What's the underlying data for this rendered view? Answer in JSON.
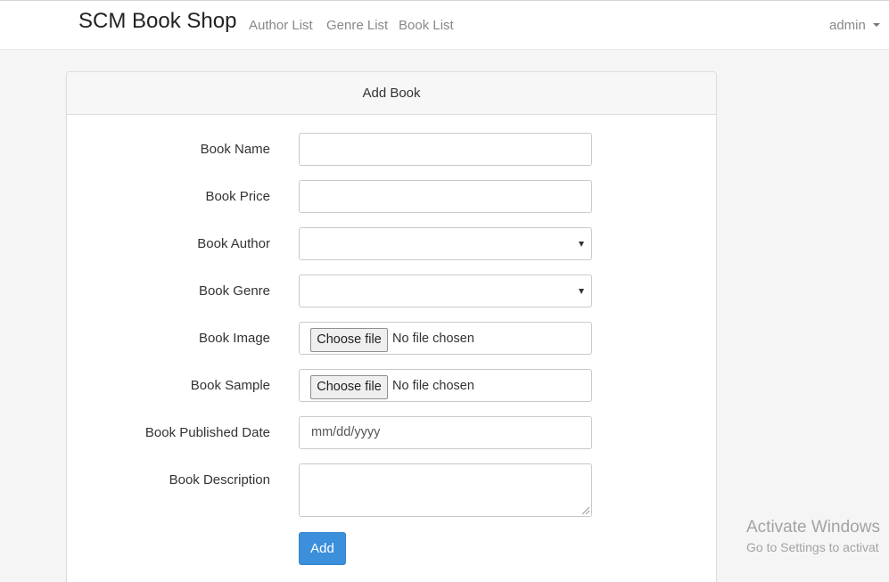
{
  "navbar": {
    "brand": "SCM Book Shop",
    "links": [
      "Author List",
      "Genre List",
      "Book List"
    ],
    "user": "admin"
  },
  "form": {
    "title": "Add Book",
    "fields": {
      "name_label": "Book Name",
      "price_label": "Book Price",
      "author_label": "Book Author",
      "genre_label": "Book Genre",
      "image_label": "Book Image",
      "sample_label": "Book Sample",
      "date_label": "Book Published Date",
      "description_label": "Book Description"
    },
    "file_button": "Choose file",
    "file_status": "No file chosen",
    "date_placeholder": "mm/dd/yyyy",
    "submit": "Add"
  },
  "watermark": {
    "title": "Activate Windows",
    "subtitle": "Go to Settings to activat"
  }
}
